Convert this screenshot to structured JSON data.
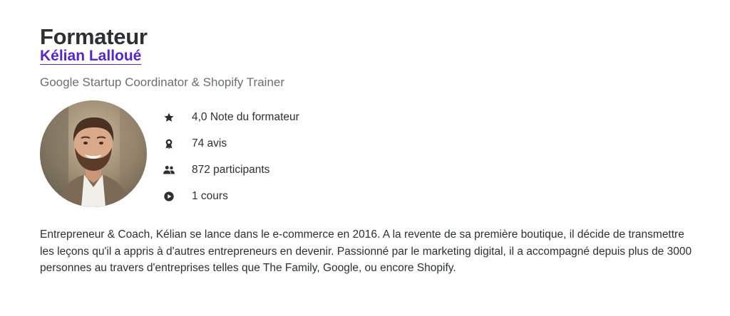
{
  "section": {
    "title": "Formateur"
  },
  "instructor": {
    "name": "Kélian Lalloué",
    "headline": "Google Startup Coordinator & Shopify Trainer",
    "stats": [
      {
        "icon": "star-icon",
        "text": "4,0 Note du formateur"
      },
      {
        "icon": "award-icon",
        "text": "74 avis"
      },
      {
        "icon": "people-icon",
        "text": "872 participants"
      },
      {
        "icon": "play-circle-icon",
        "text": "1 cours"
      }
    ],
    "bio": "Entrepreneur & Coach, Kélian se lance dans le e-commerce en 2016. A la revente de sa première boutique, il décide de transmettre les leçons qu'il a appris à d'autres entrepreneurs en devenir. Passionné par le marketing digital, il a accompagné depuis plus de 3000 personnes au travers d'entreprises telles que The Family, Google, ou encore Shopify."
  },
  "colors": {
    "link": "#5624d0",
    "text": "#2d2f31",
    "muted": "#6a6f73"
  }
}
